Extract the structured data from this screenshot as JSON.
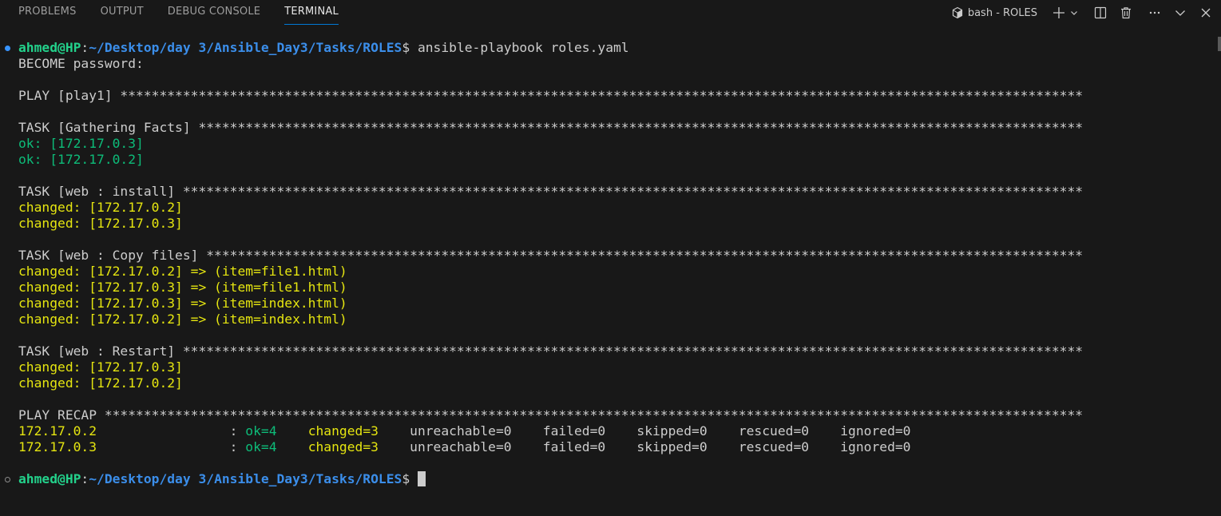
{
  "panel": {
    "tabs": [
      "PROBLEMS",
      "OUTPUT",
      "DEBUG CONSOLE",
      "TERMINAL"
    ],
    "active_tab": "TERMINAL",
    "terminal_name": "bash - ROLES"
  },
  "prompt": {
    "user": "ahmed@HP",
    "path": "~/Desktop/day 3/Ansible_Day3/Tasks/ROLES",
    "symbol": "$",
    "command": " ansible-playbook roles.yaml"
  },
  "output": {
    "become": "BECOME password:",
    "play": "PLAY [play1] ***************************************************************************************************************************",
    "task_facts": "TASK [Gathering Facts] *****************************************************************************************************************",
    "facts": [
      "ok: [172.17.0.3]",
      "ok: [172.17.0.2]"
    ],
    "task_install": "TASK [web : install] *******************************************************************************************************************",
    "install": [
      "changed: [172.17.0.2]",
      "changed: [172.17.0.3]"
    ],
    "task_copy": "TASK [web : Copy files] ****************************************************************************************************************",
    "copy": [
      "changed: [172.17.0.2] => (item=file1.html)",
      "changed: [172.17.0.3] => (item=file1.html)",
      "changed: [172.17.0.3] => (item=index.html)",
      "changed: [172.17.0.2] => (item=index.html)"
    ],
    "task_restart": "TASK [web : Restart] *******************************************************************************************************************",
    "restart": [
      "changed: [172.17.0.3]",
      "changed: [172.17.0.2]"
    ],
    "recap": "PLAY RECAP *****************************************************************************************************************************",
    "recap_rows": [
      {
        "host": "172.17.0.2                 ",
        "sep": ": ",
        "ok": "ok=4    ",
        "changed": "changed=3    ",
        "rest": "unreachable=0    failed=0    skipped=0    rescued=0    ignored=0"
      },
      {
        "host": "172.17.0.3                 ",
        "sep": ": ",
        "ok": "ok=4    ",
        "changed": "changed=3    ",
        "rest": "unreachable=0    failed=0    skipped=0    rescued=0    ignored=0"
      }
    ]
  },
  "colors": {
    "background": "#181818",
    "prompt_user": "#23d18b",
    "prompt_path": "#3b8eea",
    "ok": "#0dbc79",
    "changed": "#e5e510",
    "active_tab_underline": "#0078d4"
  },
  "icons": [
    "terminal-icon",
    "plus-icon",
    "chevron-down-icon",
    "split-icon",
    "trash-icon",
    "more-icon",
    "chevron-down-icon",
    "close-icon"
  ]
}
